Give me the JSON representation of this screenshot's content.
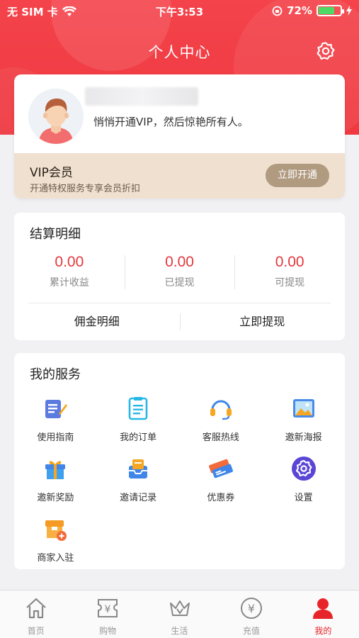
{
  "status_bar": {
    "carrier": "无 SIM 卡",
    "time": "下午3:53",
    "battery": "72%",
    "battery_level": 0.72
  },
  "header": {
    "title": "个人中心"
  },
  "profile": {
    "slogan": "悄悄开通VIP，然后惊艳所有人。",
    "vip": {
      "title": "VIP会员",
      "subtitle": "开通特权服务专享会员折扣",
      "button": "立即开通"
    }
  },
  "settlement": {
    "title": "结算明细",
    "stats": [
      {
        "value": "0.00",
        "label": "累计收益"
      },
      {
        "value": "0.00",
        "label": "已提现"
      },
      {
        "value": "0.00",
        "label": "可提现"
      }
    ],
    "actions": [
      "佣金明细",
      "立即提现"
    ]
  },
  "services": {
    "title": "我的服务",
    "items": [
      {
        "label": "使用指南",
        "icon": "guide-icon"
      },
      {
        "label": "我的订单",
        "icon": "order-icon"
      },
      {
        "label": "客服热线",
        "icon": "headset-icon"
      },
      {
        "label": "邀新海报",
        "icon": "poster-icon"
      },
      {
        "label": "邀新奖励",
        "icon": "gift-icon"
      },
      {
        "label": "邀请记录",
        "icon": "inbox-icon"
      },
      {
        "label": "优惠券",
        "icon": "coupon-icon"
      },
      {
        "label": "设置",
        "icon": "settings-icon"
      },
      {
        "label": "商家入驻",
        "icon": "merchant-icon"
      }
    ]
  },
  "tabbar": {
    "items": [
      {
        "label": "首页",
        "icon": "home-icon",
        "active": false
      },
      {
        "label": "购物",
        "icon": "shopping-icon",
        "active": false
      },
      {
        "label": "生活",
        "icon": "life-icon",
        "active": false
      },
      {
        "label": "充值",
        "icon": "recharge-icon",
        "active": false
      },
      {
        "label": "我的",
        "icon": "profile-icon",
        "active": true
      }
    ]
  },
  "colors": {
    "primary": "#ef3940",
    "vip_bg": "#efe0cf",
    "vip_button": "#b09a80",
    "amount": "#e5373d"
  }
}
